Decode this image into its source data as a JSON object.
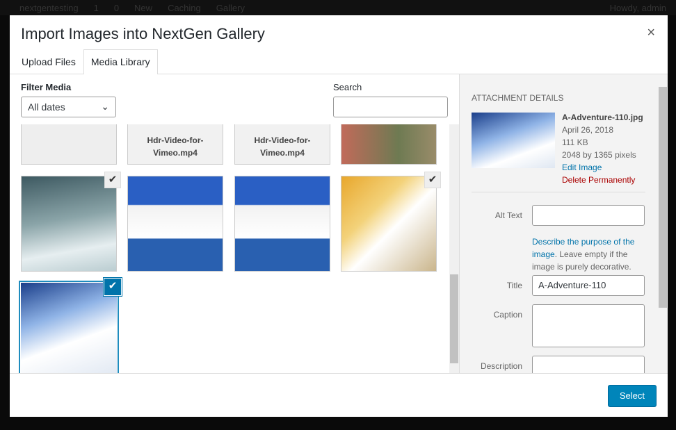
{
  "adminbar": {
    "site": "nextgentesting",
    "updates": "1",
    "comments": "0",
    "new": "New",
    "caching": "Caching",
    "gallery": "Gallery",
    "howdy": "Howdy, admin"
  },
  "modal": {
    "title": "Import Images into NextGen Gallery",
    "close": "×",
    "tabs": [
      {
        "label": "Upload Files",
        "active": false
      },
      {
        "label": "Media Library",
        "active": true
      }
    ]
  },
  "filter": {
    "label": "Filter Media",
    "value": "All dates",
    "search_label": "Search",
    "search_value": ""
  },
  "grid": {
    "files": [
      "Hdr-Video-for-Vimeo.mp4",
      "Hdr-Video-for-Vimeo.mp4"
    ],
    "check": "✔"
  },
  "details": {
    "heading": "Attachment Details",
    "filename": "A-Adventure-110.jpg",
    "date": "April 26, 2018",
    "size": "111 KB",
    "dimensions": "2048 by 1365 pixels",
    "edit": "Edit Image",
    "delete": "Delete Permanently",
    "alt_label": "Alt Text",
    "alt_value": "",
    "alt_help_link": "Describe the purpose of the image",
    "alt_help_text": ". Leave empty if the image is purely decorative.",
    "title_label": "Title",
    "title_value": "A-Adventure-110",
    "caption_label": "Caption",
    "caption_value": "",
    "description_label": "Description",
    "description_value": ""
  },
  "footer": {
    "select": "Select"
  },
  "colors": {
    "accent": "#0085ba",
    "delete": "#a00000"
  }
}
